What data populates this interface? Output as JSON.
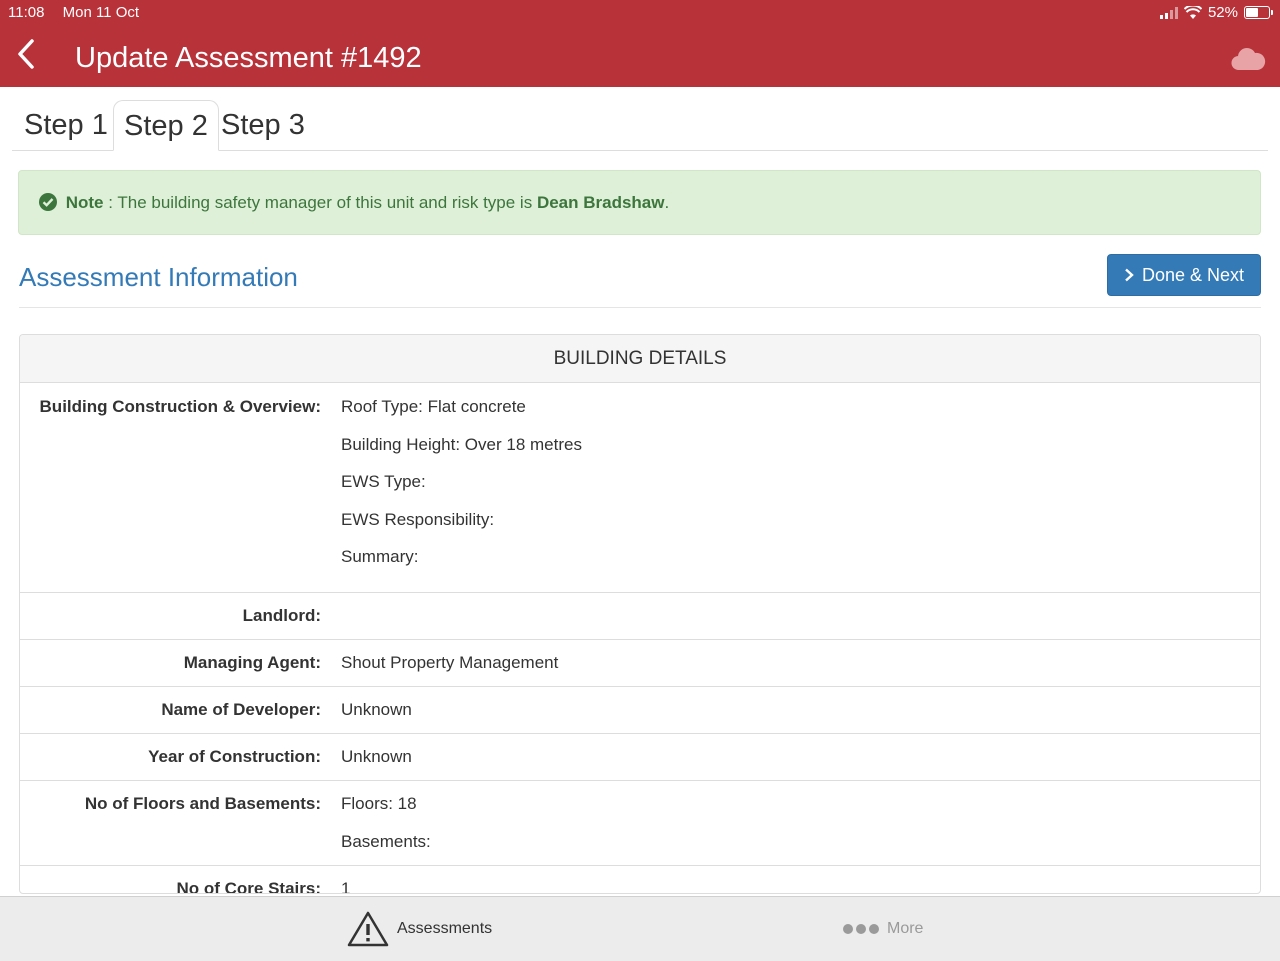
{
  "status_bar": {
    "time": "11:08",
    "date": "Mon 11 Oct",
    "battery": "52%"
  },
  "header": {
    "title": "Update Assessment #1492"
  },
  "tabs": [
    {
      "label": "Step 1"
    },
    {
      "label": "Step 2",
      "active": true
    },
    {
      "label": "Step 3"
    }
  ],
  "alert": {
    "prefix": "Note",
    "text": " : The building safety manager of this unit and risk type is ",
    "name": "Dean Bradshaw",
    "suffix": "."
  },
  "section": {
    "title": "Assessment Information",
    "button_label": "Done & Next"
  },
  "panel": {
    "heading": "BUILDING DETAILS",
    "rows": [
      {
        "label": "Building Construction & Overview:",
        "values": [
          "Roof Type: Flat concrete",
          "Building Height: Over 18 metres",
          "EWS Type:",
          "EWS Responsibility:",
          "Summary:"
        ]
      },
      {
        "label": "Landlord:",
        "values": [
          ""
        ]
      },
      {
        "label": "Managing Agent:",
        "values": [
          "Shout Property Management"
        ]
      },
      {
        "label": "Name of Developer:",
        "values": [
          "Unknown"
        ]
      },
      {
        "label": "Year of Construction:",
        "values": [
          "Unknown"
        ]
      },
      {
        "label": "No of Floors and Basements:",
        "values": [
          "Floors: 18",
          "Basements:"
        ]
      },
      {
        "label": "No of Core Stairs:",
        "values": [
          "1"
        ]
      }
    ]
  },
  "bottom_nav": {
    "assessments_label": "Assessments",
    "more_label": "More"
  },
  "colors": {
    "header": "#b8323a",
    "accent": "#337ab7",
    "alert_bg": "#dff0d8",
    "alert_text": "#3c763d"
  }
}
